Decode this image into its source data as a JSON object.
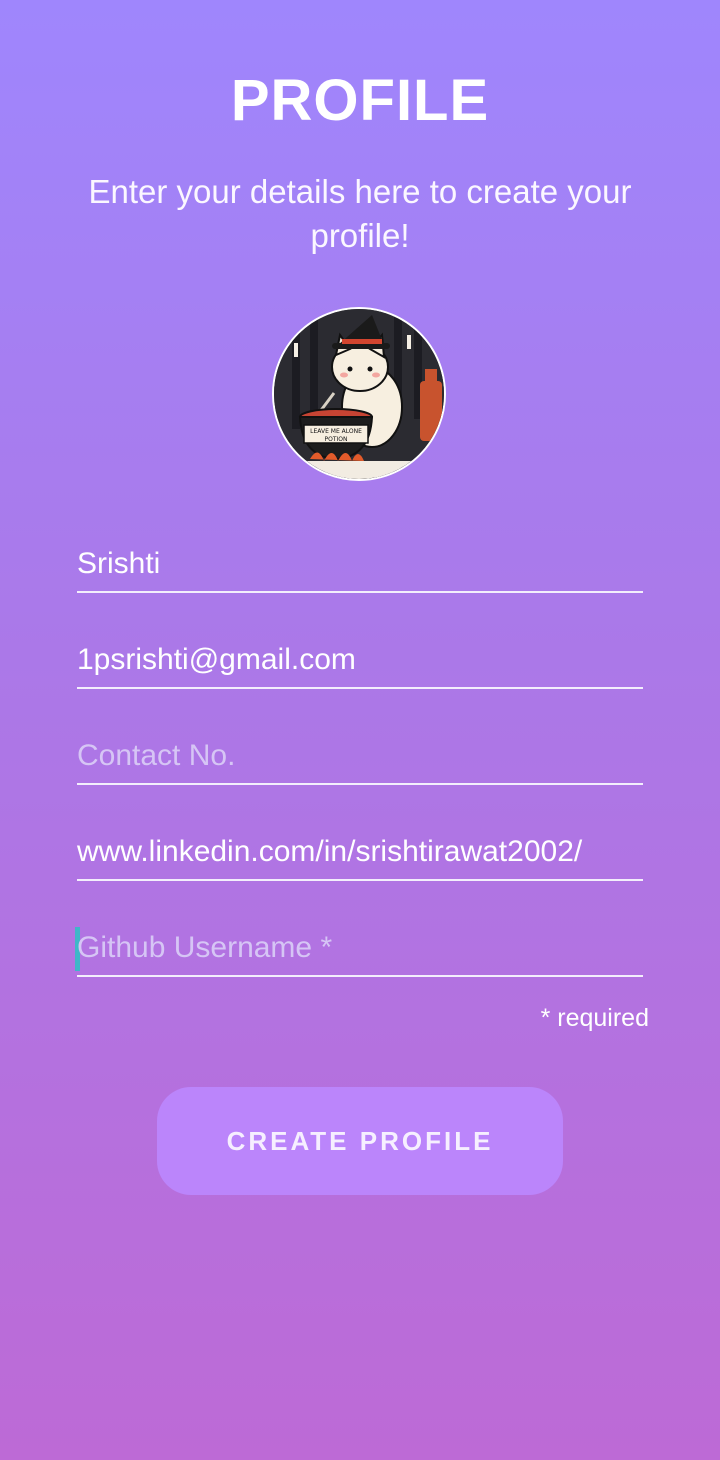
{
  "header": {
    "title": "PROFILE",
    "subtitle": "Enter your details here to create your profile!"
  },
  "avatar": {
    "icon": "cat-witch-avatar-image",
    "caption": "LEAVE ME ALONE POTION"
  },
  "form": {
    "name": {
      "value": "Srishti"
    },
    "email": {
      "value": "1psrishti@gmail.com"
    },
    "contact": {
      "value": "",
      "placeholder": "Contact No."
    },
    "linkedin": {
      "value": "www.linkedin.com/in/srishtirawat2002/"
    },
    "github": {
      "value": "",
      "placeholder": "Github Username *"
    },
    "required_note": "* required"
  },
  "actions": {
    "create_label": "CREATE PROFILE"
  },
  "colors": {
    "gradient_top": "#9f86fd",
    "gradient_bottom": "#bd6ad6",
    "button": "#bb85fb",
    "cursor": "#3fb6c8"
  }
}
